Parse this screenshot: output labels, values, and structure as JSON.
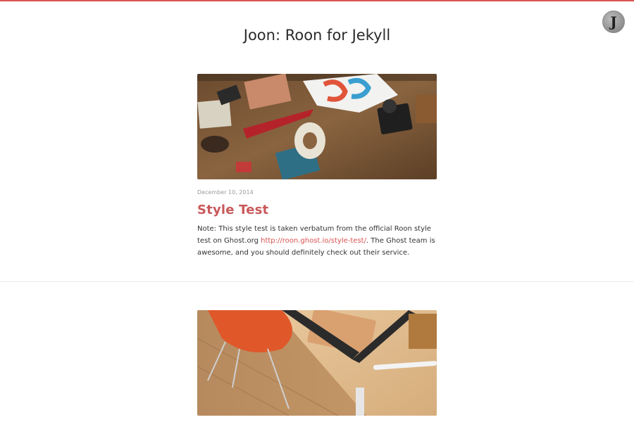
{
  "header": {
    "site_title": "Joon: Roon for Jekyll",
    "avatar_letter": "J",
    "accent_color": "#d9534f"
  },
  "posts": [
    {
      "date": "December 10, 2014",
      "title": "Style Test",
      "excerpt_before": " Note: This style test is taken verbatum from the official Roon style test on Ghost.org ",
      "excerpt_link": "http://roon.ghost.io/style-test/",
      "excerpt_after": ". The Ghost team is awesome, and you should definitely check out their service.",
      "title_color": "#c9585a"
    },
    {
      "date": "",
      "title": ""
    }
  ]
}
